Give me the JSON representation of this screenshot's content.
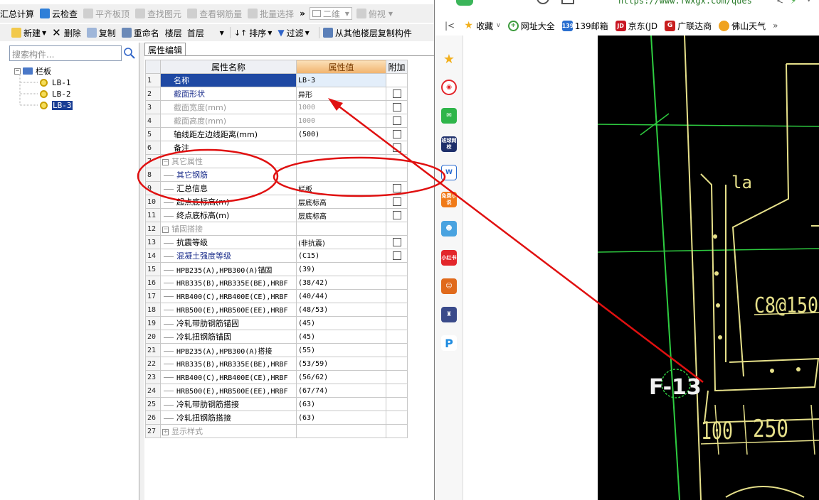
{
  "toolbar1": {
    "summary_calc": "汇总计算",
    "cloud_check": "云检查",
    "flat_top": "平齐板顶",
    "find_element": "查找图元",
    "view_rebar": "查看钢筋量",
    "batch_select": "批量选择",
    "more": "»",
    "view_mode": "二维",
    "view_angle": "俯视"
  },
  "toolbar2": {
    "new": "新建",
    "delete": "删除",
    "copy": "复制",
    "rename": "重命名",
    "floor_label": "楼层",
    "floor_value": "首层",
    "sort": "排序",
    "filter": "过滤",
    "copy_from_floor": "从其他楼层复制构件"
  },
  "left_panel": {
    "search_placeholder": "搜索构件...",
    "tree_root": "栏板",
    "items": [
      "LB-1",
      "LB-2",
      "LB-3"
    ],
    "selected_index": 2
  },
  "property_editor": {
    "tab_label": "属性编辑",
    "col_name": "属性名称",
    "col_value": "属性值",
    "col_extra": "附加",
    "rows": [
      {
        "n": "1",
        "name": "名称",
        "value": "LB-3",
        "style": "selected",
        "check": false
      },
      {
        "n": "2",
        "name": "截面形状",
        "value": "异形",
        "style": "blue",
        "check": true
      },
      {
        "n": "3",
        "name": "截面宽度(mm)",
        "value": "1000",
        "style": "gray",
        "check": true
      },
      {
        "n": "4",
        "name": "截面高度(mm)",
        "value": "1000",
        "style": "gray",
        "check": true
      },
      {
        "n": "5",
        "name": "轴线距左边线距离(mm)",
        "value": "(500)",
        "style": "",
        "check": true
      },
      {
        "n": "6",
        "name": "备注",
        "value": "",
        "style": "",
        "check": true
      },
      {
        "n": "7",
        "name": "其它属性",
        "value": "",
        "style": "group",
        "check": false
      },
      {
        "n": "8",
        "name": "其它钢筋",
        "value": "",
        "style": "child-blue",
        "check": false
      },
      {
        "n": "9",
        "name": "汇总信息",
        "value": "栏板",
        "style": "child",
        "check": true
      },
      {
        "n": "10",
        "name": "起点底标高(m)",
        "value": "层底标高",
        "style": "child",
        "check": true
      },
      {
        "n": "11",
        "name": "终点底标高(m)",
        "value": "层底标高",
        "style": "child",
        "check": true
      },
      {
        "n": "12",
        "name": "锚固搭接",
        "value": "",
        "style": "group",
        "check": false
      },
      {
        "n": "13",
        "name": "抗震等级",
        "value": "(非抗震)",
        "style": "child",
        "check": true
      },
      {
        "n": "14",
        "name": "混凝土强度等级",
        "value": "(C15)",
        "style": "child-blue",
        "check": true
      },
      {
        "n": "15",
        "name": "HPB235(A),HPB300(A)锚固",
        "value": "(39)",
        "style": "child-mono",
        "check": false
      },
      {
        "n": "16",
        "name": "HRB335(B),HRB335E(BE),HRBF",
        "value": "(38/42)",
        "style": "child-mono",
        "check": false
      },
      {
        "n": "17",
        "name": "HRB400(C),HRB400E(CE),HRBF",
        "value": "(40/44)",
        "style": "child-mono",
        "check": false
      },
      {
        "n": "18",
        "name": "HRB500(E),HRB500E(EE),HRBF",
        "value": "(48/53)",
        "style": "child-mono",
        "check": false
      },
      {
        "n": "19",
        "name": "冷轧带肋钢筋锚固",
        "value": "(45)",
        "style": "child",
        "check": false
      },
      {
        "n": "20",
        "name": "冷轧扭钢筋锚固",
        "value": "(45)",
        "style": "child",
        "check": false
      },
      {
        "n": "21",
        "name": "HPB235(A),HPB300(A)搭接",
        "value": "(55)",
        "style": "child-mono",
        "check": false
      },
      {
        "n": "22",
        "name": "HRB335(B),HRB335E(BE),HRBF",
        "value": "(53/59)",
        "style": "child-mono",
        "check": false
      },
      {
        "n": "23",
        "name": "HRB400(C),HRB400E(CE),HRBF",
        "value": "(56/62)",
        "style": "child-mono",
        "check": false
      },
      {
        "n": "24",
        "name": "HRB500(E),HRB500E(EE),HRBF",
        "value": "(67/74)",
        "style": "child-mono",
        "check": false
      },
      {
        "n": "25",
        "name": "冷轧带肋钢筋搭接",
        "value": "(63)",
        "style": "child",
        "check": false
      },
      {
        "n": "26",
        "name": "冷轧扭钢筋搭接",
        "value": "(63)",
        "style": "child",
        "check": false
      },
      {
        "n": "27",
        "name": "显示样式",
        "value": "",
        "style": "group-plus",
        "check": false
      }
    ]
  },
  "browser": {
    "url": "https://www.fwxgx.com/ques",
    "bookmarks": [
      "收藏",
      "网址大全",
      "139邮箱",
      "京东(JD",
      "广联达商",
      "佛山天气"
    ],
    "more": "»",
    "sidebar_labels": [
      "班球网校",
      "免费小说",
      "小红书"
    ]
  },
  "cad": {
    "label_la": "la",
    "label_rebar": "C8@150",
    "label_axis": "F-13",
    "dim1": "100",
    "dim2": "250"
  },
  "colors": {
    "annotation_red": "#e01010",
    "selected_blue": "#1f49a3",
    "cad_green": "#2ecc40",
    "cad_yellow": "#e6e08a"
  }
}
